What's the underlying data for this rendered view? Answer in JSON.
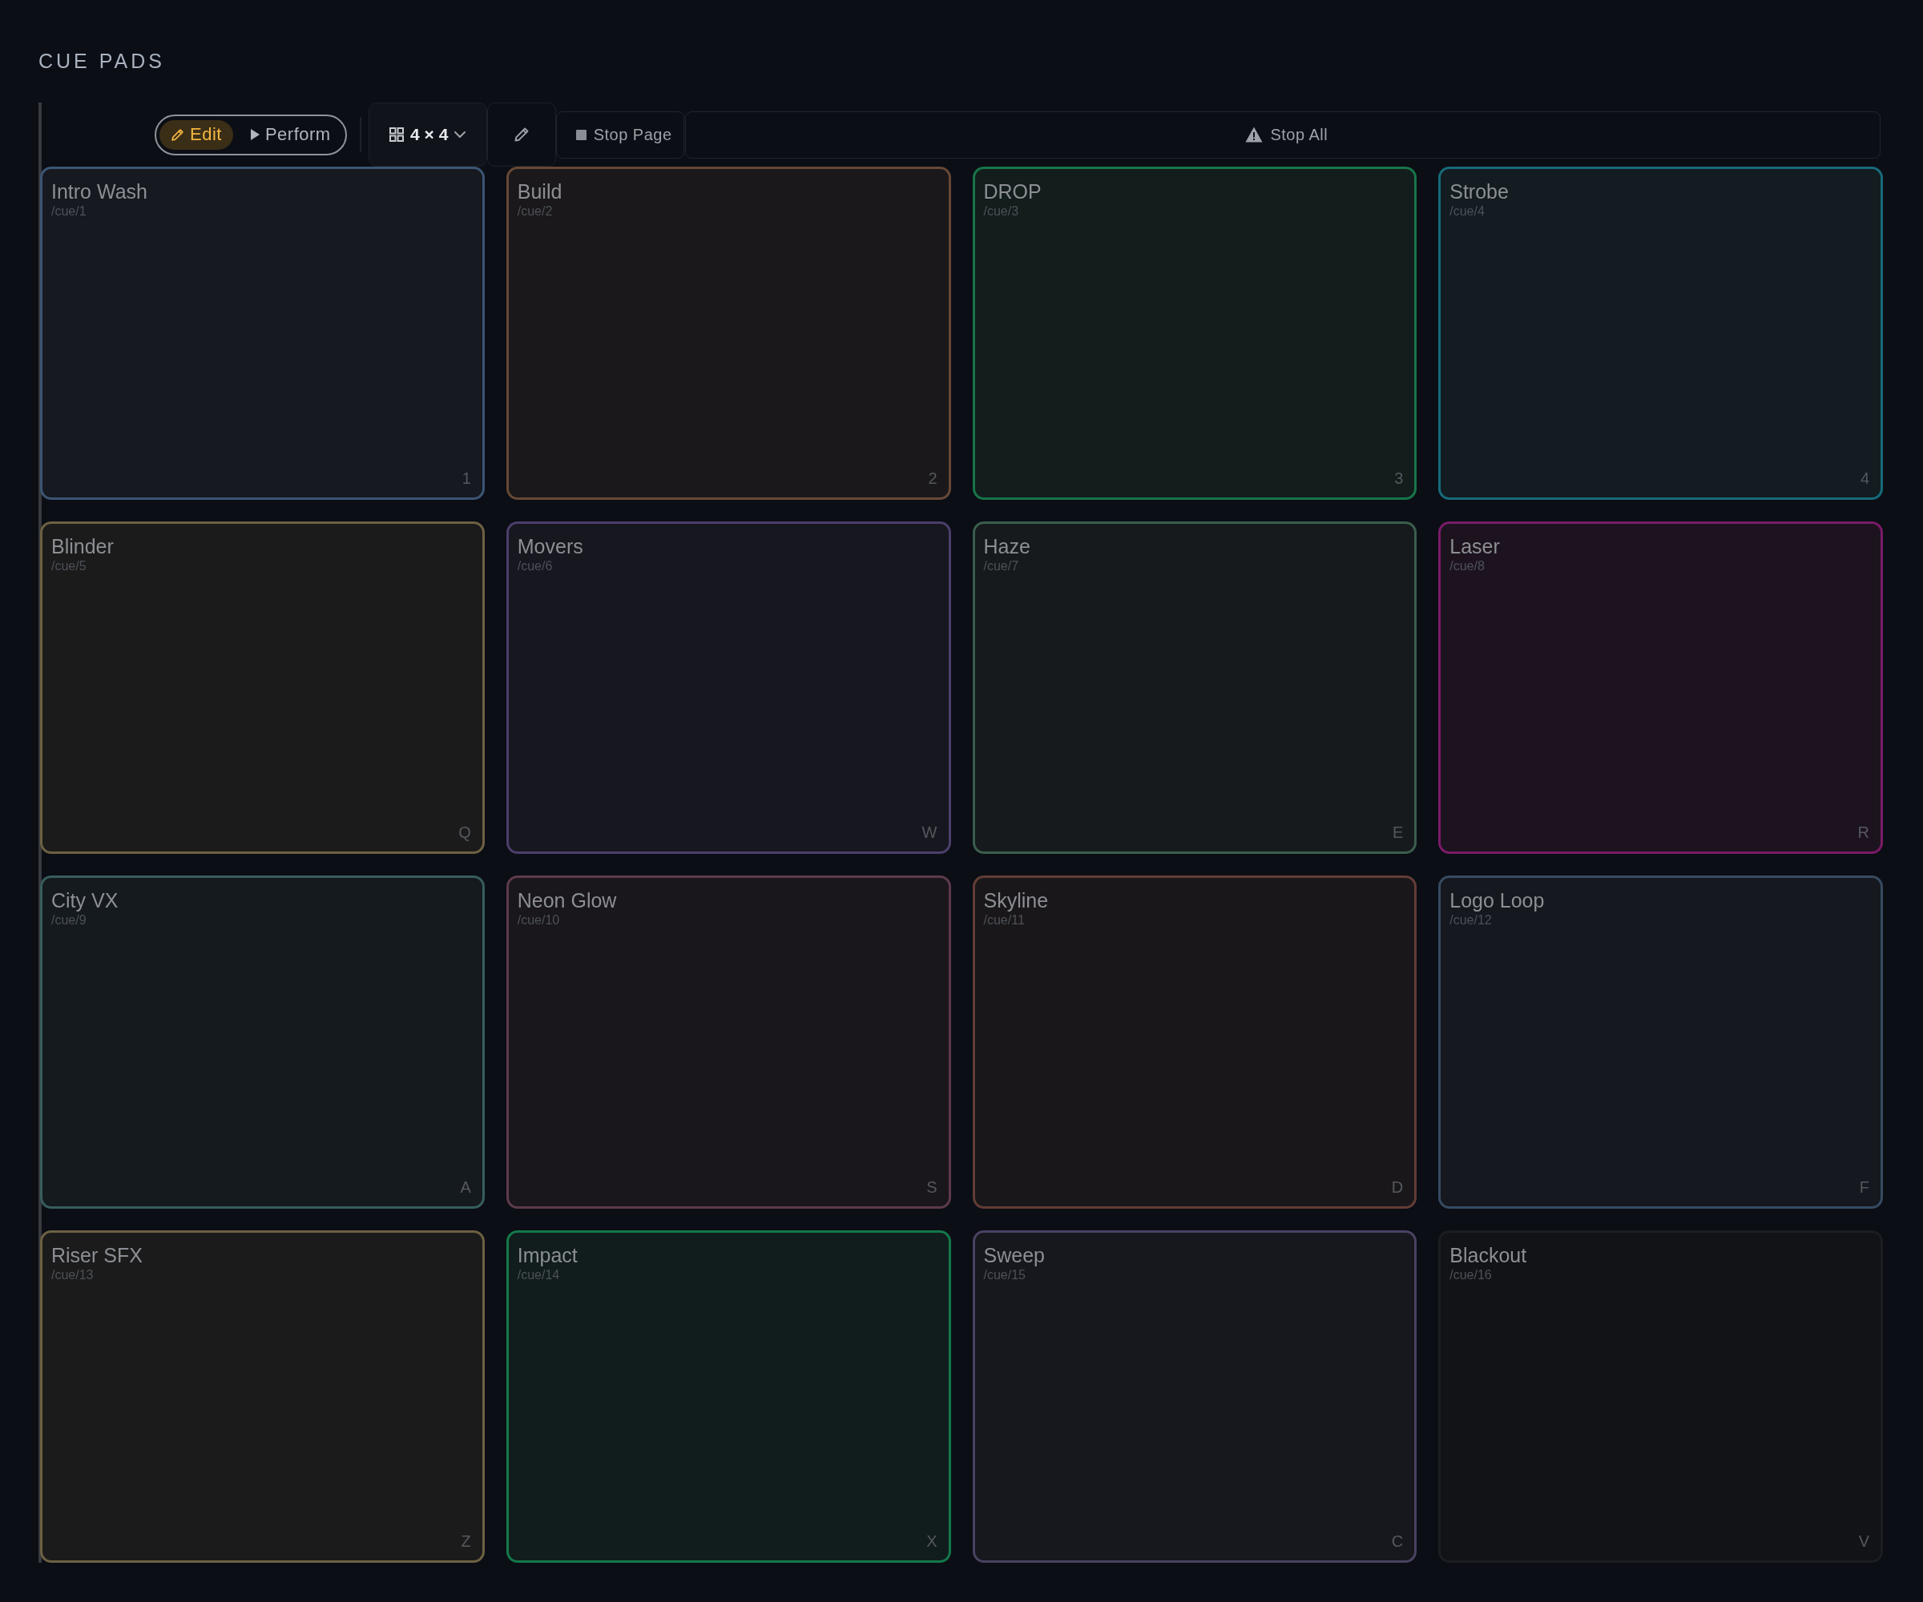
{
  "title": "CUE PADS",
  "toolbar": {
    "modes": [
      {
        "kind": "edit",
        "label": "Edit",
        "selected": true
      },
      {
        "kind": "perform",
        "label": "Perform",
        "selected": false
      }
    ],
    "grid_size": "4 × 4",
    "stop_page": "Stop Page",
    "stop_all": "Stop All"
  },
  "pads": [
    {
      "name": "Intro Wash",
      "path": "/cue/1",
      "key": "1",
      "color": "#3b5573"
    },
    {
      "name": "Build",
      "path": "/cue/2",
      "key": "2",
      "color": "#664836"
    },
    {
      "name": "DROP",
      "path": "/cue/3",
      "key": "3",
      "color": "#17754a"
    },
    {
      "name": "Strobe",
      "path": "/cue/4",
      "key": "4",
      "color": "#176a7a"
    },
    {
      "name": "Blinder",
      "path": "/cue/5",
      "key": "Q",
      "color": "#6d6142"
    },
    {
      "name": "Movers",
      "path": "/cue/6",
      "key": "W",
      "color": "#4b3f6b"
    },
    {
      "name": "Haze",
      "path": "/cue/7",
      "key": "E",
      "color": "#3a5e4c"
    },
    {
      "name": "Laser",
      "path": "/cue/8",
      "key": "R",
      "color": "#7a1b68"
    },
    {
      "name": "City VX",
      "path": "/cue/9",
      "key": "A",
      "color": "#375e5c"
    },
    {
      "name": "Neon Glow",
      "path": "/cue/10",
      "key": "S",
      "color": "#5d3a4c"
    },
    {
      "name": "Skyline",
      "path": "/cue/11",
      "key": "D",
      "color": "#623d36"
    },
    {
      "name": "Logo Loop",
      "path": "/cue/12",
      "key": "F",
      "color": "#374b62"
    },
    {
      "name": "Riser SFX",
      "path": "/cue/13",
      "key": "Z",
      "color": "#6d6142"
    },
    {
      "name": "Impact",
      "path": "/cue/14",
      "key": "X",
      "color": "#14784a"
    },
    {
      "name": "Sweep",
      "path": "/cue/15",
      "key": "C",
      "color": "#4a4262"
    },
    {
      "name": "Blackout",
      "path": "/cue/16",
      "key": "V",
      "color": "#1c1d21"
    }
  ]
}
